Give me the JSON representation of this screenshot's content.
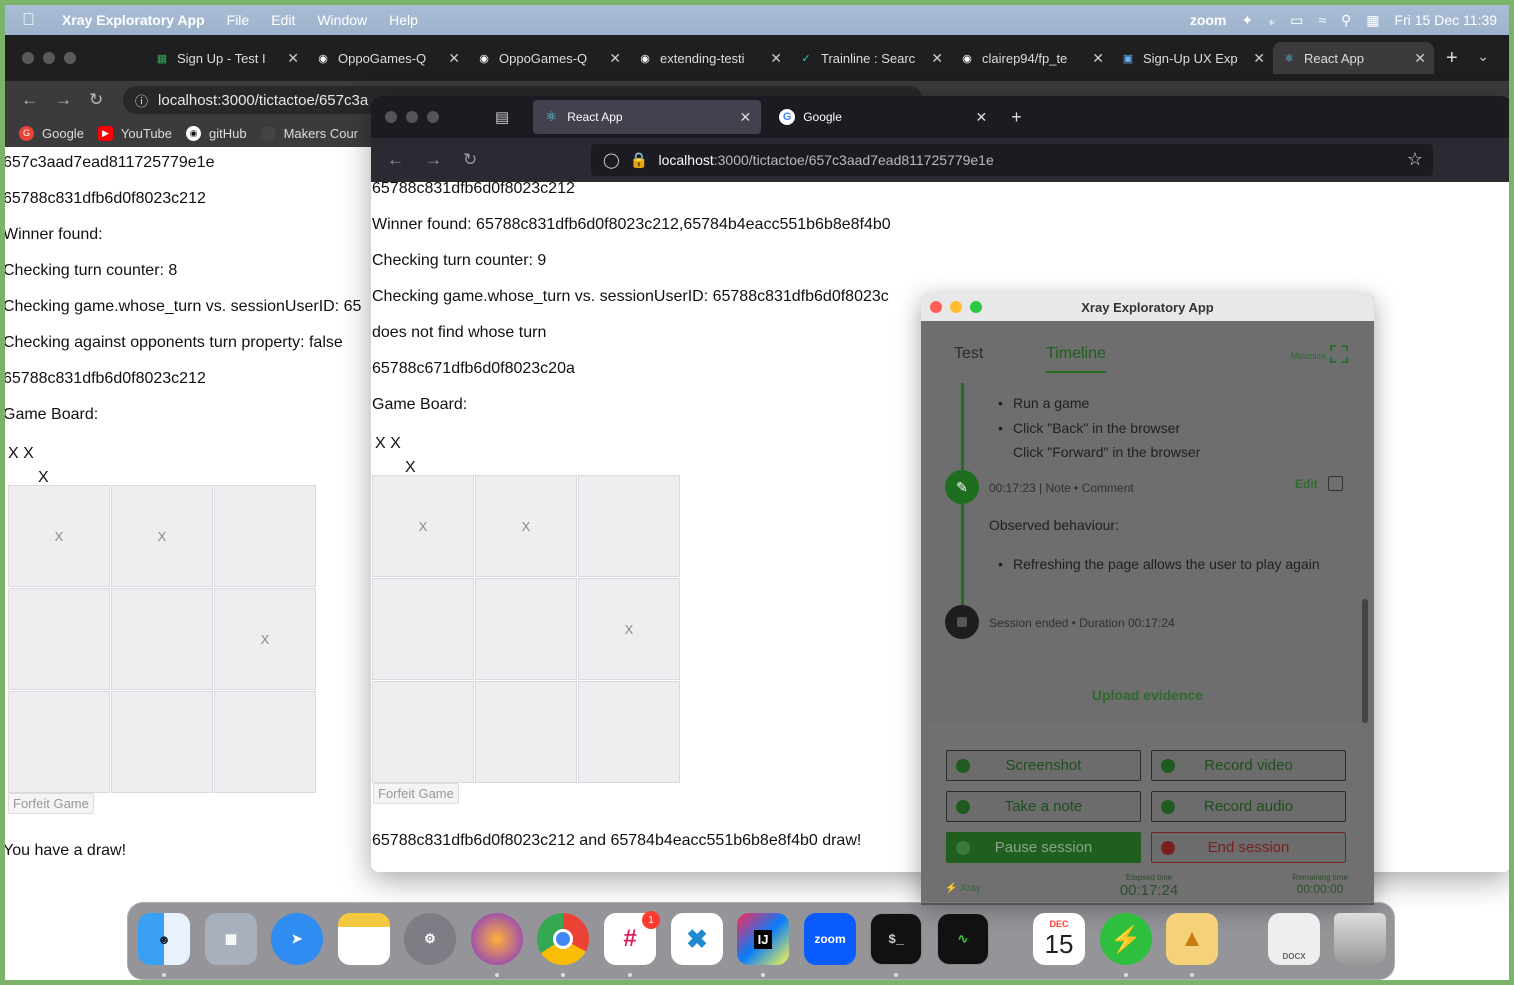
{
  "menubar": {
    "app_name": "Xray Exploratory App",
    "menus": [
      "File",
      "Edit",
      "Window",
      "Help"
    ],
    "right": {
      "zoom": "zoom",
      "datetime": "Fri 15 Dec  11:39"
    }
  },
  "chrome": {
    "tabs": [
      {
        "title": "Sign Up - Test I",
        "icon": "sheets-icon",
        "color": "#34a853"
      },
      {
        "title": "OppoGames-Q",
        "icon": "github-icon",
        "color": "#ffffff"
      },
      {
        "title": "OppoGames-Q",
        "icon": "github-icon",
        "color": "#ffffff"
      },
      {
        "title": "extending-testi",
        "icon": "github-icon",
        "color": "#ffffff"
      },
      {
        "title": "Trainline : Searc",
        "icon": "trainline-icon",
        "color": "#3ccfb0"
      },
      {
        "title": "clairep94/fp_te",
        "icon": "github-icon",
        "color": "#ffffff"
      },
      {
        "title": "Sign-Up UX Exp",
        "icon": "doc-icon",
        "color": "#64b5f6"
      },
      {
        "title": "React App",
        "icon": "react-icon",
        "color": "#61dafb"
      }
    ],
    "url": "localhost:3000/tictactoe/657c3a",
    "bookmarks": [
      {
        "label": "Google",
        "color": "#ea4335"
      },
      {
        "label": "YouTube",
        "color": "#ff0000"
      },
      {
        "label": "gitHub",
        "color": "#ffffff"
      },
      {
        "label": "Makers Cour",
        "color": "#444444"
      }
    ],
    "page": {
      "lines": [
        "657c3aad7ead811725779e1e",
        "65788c831dfb6d0f8023c212",
        "Winner found:",
        "Checking turn counter: 8",
        "Checking game.whose_turn vs. sessionUserID: 65",
        "Checking against opponents turn property: false",
        "65788c831dfb6d0f8023c212",
        "Game Board:"
      ],
      "board_rows_text": [
        "X X",
        "X"
      ],
      "board": [
        "X",
        "X",
        "",
        "",
        "",
        "X",
        "",
        "",
        ""
      ],
      "forfeit": "Forfeit Game",
      "result": "You have a draw!"
    }
  },
  "firefox": {
    "tabs": [
      {
        "title": "React App",
        "icon": "react-icon"
      },
      {
        "title": "Google",
        "icon": "google-icon"
      }
    ],
    "url_host": "localhost",
    "url_path": ":3000/tictactoe/657c3aad7ead811725779e1e",
    "page": {
      "lines": [
        "65788c831dfb6d0f8023c212",
        "Winner found: 65788c831dfb6d0f8023c212,65784b4eacc551b6b8e8f4b0",
        "Checking turn counter: 9",
        "Checking game.whose_turn vs. sessionUserID: 65788c831dfb6d0f8023c",
        "does not find whose turn",
        "65788c671dfb6d0f8023c20a",
        "Game Board:"
      ],
      "board_rows_text": [
        "X X",
        "X"
      ],
      "board": [
        "X",
        "X",
        "",
        "",
        "",
        "X",
        "",
        "",
        ""
      ],
      "forfeit": "Forfeit Game",
      "result": "65788c831dfb6d0f8023c212 and 65784b4eacc551b6b8e8f4b0 draw!"
    }
  },
  "xray": {
    "title": "Xray Exploratory App",
    "tabs": {
      "test": "Test",
      "timeline": "Timeline",
      "minimize": "Minimize"
    },
    "steps": [
      "Run a game",
      "Click \"Back\" in the browser",
      "Click \"Forward\" in the browser"
    ],
    "note": {
      "meta": "00:17:23 | Note • Comment",
      "edit": "Edit",
      "heading": "Observed behaviour:",
      "bullet": "Refreshing the page allows the user to play again"
    },
    "session_end": "Session ended • Duration 00:17:24",
    "upload": "Upload evidence",
    "buttons": {
      "screenshot": "Screenshot",
      "record_video": "Record video",
      "take_note": "Take a note",
      "record_audio": "Record audio",
      "pause": "Pause session",
      "end": "End session"
    },
    "footer": {
      "logo": "Xray",
      "elapsed_label": "Elapsed time",
      "elapsed": "00:17:24",
      "remaining_label": "Remaining time",
      "remaining": "00:00:00"
    }
  },
  "dock": {
    "calendar_month": "DEC",
    "calendar_day": "15",
    "zoom_label": "zoom",
    "intellij_label": "IJ",
    "docx_label": "DOCX",
    "slack_badge": "1",
    "apps": [
      "finder-icon",
      "launchpad-icon",
      "safari-icon",
      "notes-icon",
      "settings-icon",
      "firefox-icon",
      "chrome-icon",
      "slack-icon",
      "vscode-icon",
      "intellij-icon",
      "zoom-icon",
      "terminal-icon",
      "activity-monitor-icon",
      "calendar-icon",
      "bolt-icon",
      "tableplus-icon",
      "document-icon",
      "trash-icon"
    ]
  }
}
